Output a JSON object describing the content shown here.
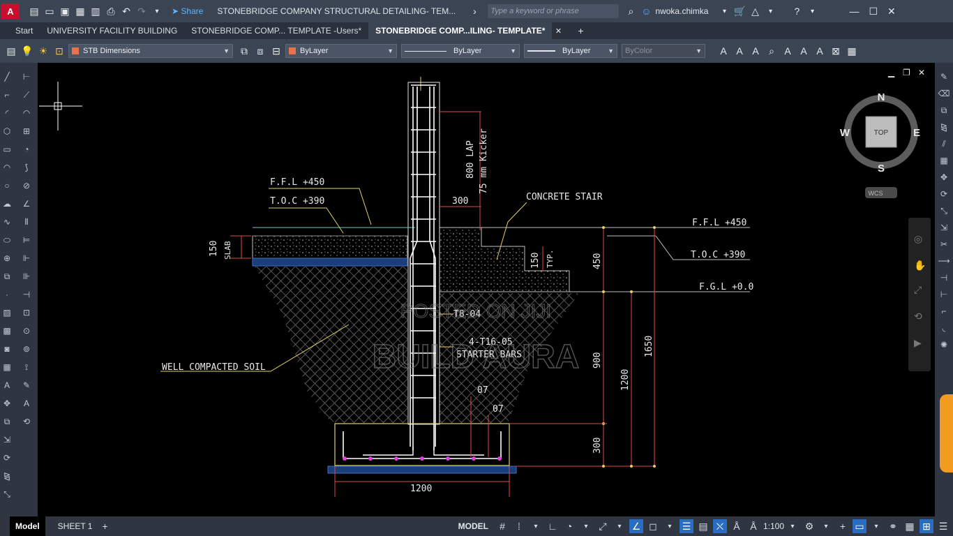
{
  "app": {
    "logo_text": "A CAD",
    "doc_title": "STONEBRIDGE COMPANY STRUCTURAL DETAILING- TEM...",
    "share_label": "Share",
    "search_placeholder": "Type a keyword or phrase",
    "user_name": "nwoka.chimka"
  },
  "tabs": [
    "Start",
    "UNIVERSITY FACILITY BUILDING",
    "STONEBRIDGE COMP... TEMPLATE -Users*",
    "STONEBRIDGE COMP...ILING- TEMPLATE*"
  ],
  "ribbon": {
    "dimstyle": "STB Dimensions",
    "color": "ByLayer",
    "linetype": "ByLayer",
    "lineweight": "ByLayer",
    "plotstyle": "ByColor"
  },
  "viewcube": {
    "north": "N",
    "south": "S",
    "east": "E",
    "west": "W",
    "face": "TOP",
    "ucs": "WCS"
  },
  "drawing": {
    "ffl_left": "F.F.L  +450",
    "toc_left": "T.O.C  +390",
    "slab": "SLAB",
    "slab_dim": "150",
    "lap": "800  LAP",
    "kicker": "75  mm  Kicker",
    "dim_300_top": "300",
    "concrete_stair": "CONCRETE  STAIR",
    "ffl_right": "F.F.L  +450",
    "toc_right": "T.O.C  +390",
    "fgl": "F.G.L  +0.0",
    "typ": "TYP.",
    "step_dim": "150",
    "dim_450": "450",
    "dim_900": "900",
    "dim_1200_v": "1200",
    "dim_1650": "1650",
    "dim_300_bottom": "300",
    "dim_1200_h": "1200",
    "soil": "WELL  COMPACTED  SOIL",
    "bar_label_1": "4-T16-05",
    "bar_label_2": "STARTER  BARS",
    "label_t8": "T8-04",
    "label_07a": "07",
    "label_07b": "07"
  },
  "watermark": {
    "line1": "POSTED ON JIJI",
    "line2": "BUILD AURA"
  },
  "status": {
    "model_tab": "Model",
    "sheet_tab": "SHEET 1",
    "model_label": "MODEL",
    "scale": "1:100"
  }
}
